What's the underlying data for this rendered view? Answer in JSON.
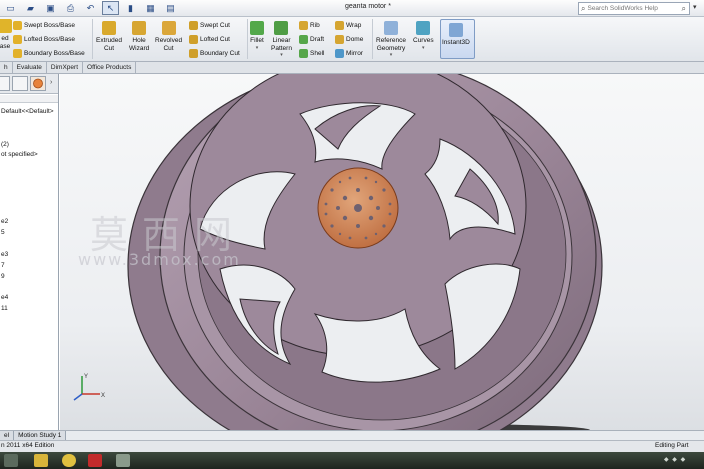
{
  "window": {
    "title": "geanta motor *"
  },
  "search": {
    "placeholder": "Search SolidWorks Help"
  },
  "ribbon": {
    "partial_left_1": "ed",
    "partial_left_2": "ase",
    "swept_boss": "Swept Boss/Base",
    "lofted_boss": "Lofted Boss/Base",
    "boundary_boss": "Boundary Boss/Base",
    "extruded_cut_1": "Extruded",
    "extruded_cut_2": "Cut",
    "hole_wizard_1": "Hole",
    "hole_wizard_2": "Wizard",
    "revolved_cut_1": "Revolved",
    "revolved_cut_2": "Cut",
    "swept_cut": "Swept Cut",
    "lofted_cut": "Lofted Cut",
    "boundary_cut": "Boundary Cut",
    "fillet": "Fillet",
    "linear_pattern_1": "Linear",
    "linear_pattern_2": "Pattern",
    "rib": "Rib",
    "draft": "Draft",
    "shell": "Shell",
    "wrap": "Wrap",
    "dome": "Dome",
    "mirror": "Mirror",
    "reference_geometry_1": "Reference",
    "reference_geometry_2": "Geometry",
    "curves": "Curves",
    "instant3d": "Instant3D"
  },
  "command_tabs": [
    "h",
    "Evaluate",
    "DimXpert",
    "Office Products"
  ],
  "tree": {
    "items": [
      "Default<<Default>",
      "(2)",
      "ot specified>",
      "e2",
      "5",
      "e3",
      "7",
      "9",
      "e4",
      "11"
    ]
  },
  "watermark": {
    "line1": "莫西网",
    "line2": "www.3dmox.com"
  },
  "model_tabs": [
    "el",
    "Motion Study 1"
  ],
  "status": {
    "left": "n 2011 x64 Edition",
    "right": "Editing Part"
  },
  "colors": {
    "wheel": "#9a8597",
    "wheel_edge": "#3a3339",
    "hub": "#c8764a",
    "ribbon_bg": "#e6e9ed"
  }
}
